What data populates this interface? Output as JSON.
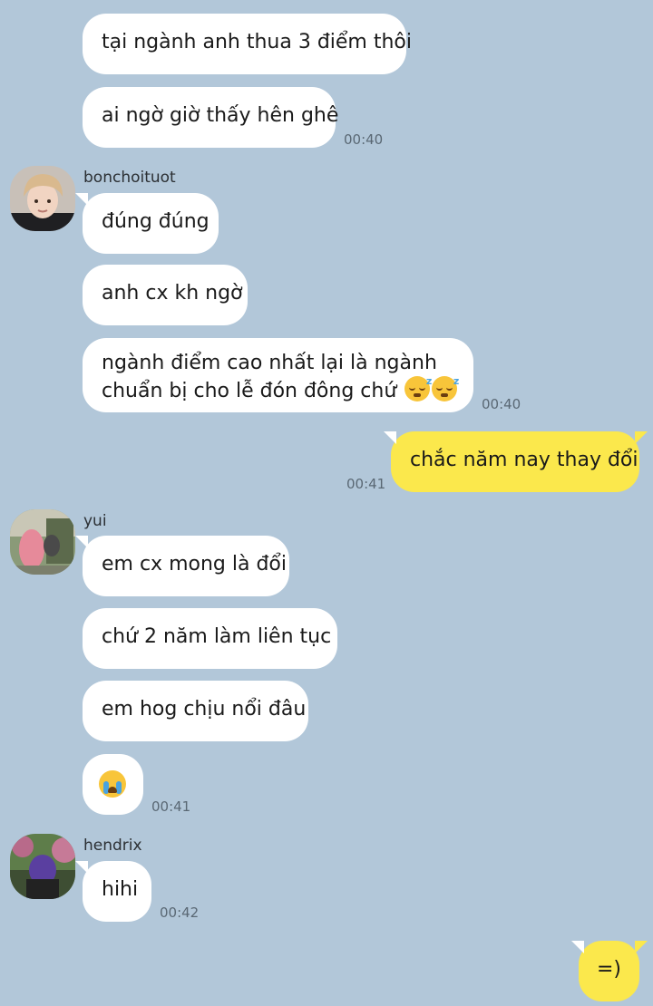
{
  "colors": {
    "background": "#b2c7d9",
    "incoming_bubble": "#ffffff",
    "outgoing_bubble": "#fbe84c"
  },
  "messages": [
    {
      "text": "tại ngành anh thua 3 điểm thôi"
    },
    {
      "text": "ai ngờ giờ thấy hên ghê",
      "time": "00:40"
    },
    {
      "sender": "bonchoituot",
      "avatar_icon": "avatar-photo-blond-man"
    },
    {
      "text": "đúng đúng"
    },
    {
      "text": "anh cx kh ngờ"
    },
    {
      "text_line1": "ngành điểm cao nhất lại là ngành",
      "text_line2": "chuẩn bị cho lễ đón đông chứ",
      "emoji_icon": "sleeping-face-icon",
      "time": "00:40"
    },
    {
      "text": "chắc năm nay thay đổi",
      "time": "00:41",
      "outgoing": true
    },
    {
      "sender": "yui",
      "avatar_icon": "avatar-photo-pink-hair"
    },
    {
      "text": "em cx mong là đổi"
    },
    {
      "text": "chứ 2 năm làm liên tục"
    },
    {
      "text": "em hog chịu nổi đâu"
    },
    {
      "emoji_icon": "loudly-crying-face-icon",
      "time": "00:41"
    },
    {
      "sender": "hendrix",
      "avatar_icon": "avatar-photo-purple-hair"
    },
    {
      "text": "hihi",
      "time": "00:42"
    },
    {
      "text": "=)",
      "outgoing": true
    }
  ]
}
